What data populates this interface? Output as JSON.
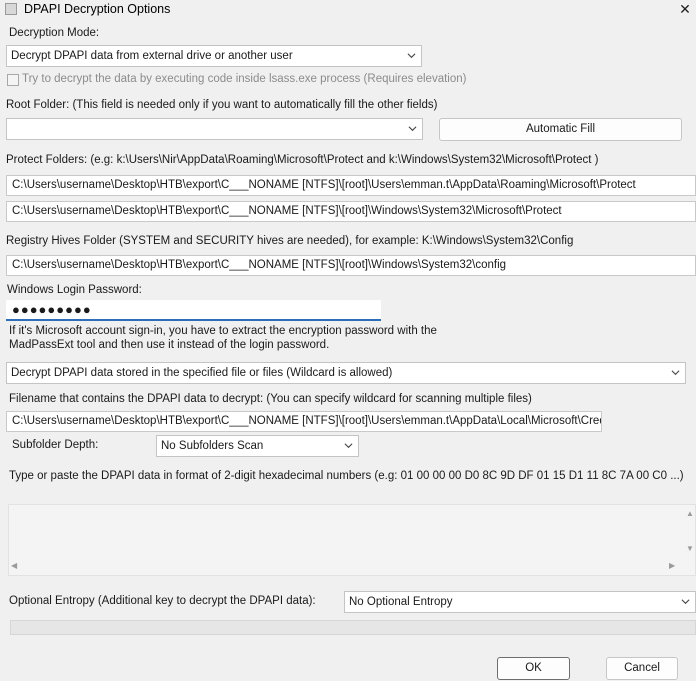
{
  "window": {
    "title": "DPAPI Decryption Options",
    "close_glyph": "✕"
  },
  "decryption_mode": {
    "label": "Decryption Mode:",
    "selected": "Decrypt DPAPI data from external drive or another user"
  },
  "lsass_option": {
    "label": "Try to decrypt the data by executing code inside lsass.exe process (Requires elevation)",
    "checked": false,
    "enabled": false
  },
  "root_folder": {
    "label": "Root Folder: (This field is needed only if you want to automatically fill the other fields)",
    "value": "",
    "auto_fill_label": "Automatic Fill"
  },
  "protect_folders": {
    "label": "Protect Folders: (e.g: k:\\Users\\Nir\\AppData\\Roaming\\Microsoft\\Protect and k:\\Windows\\System32\\Microsoft\\Protect )",
    "value_1": "C:\\Users\\username\\Desktop\\HTB\\export\\C___NONAME [NTFS]\\[root]\\Users\\emman.t\\AppData\\Roaming\\Microsoft\\Protect",
    "value_2": "C:\\Users\\username\\Desktop\\HTB\\export\\C___NONAME [NTFS]\\[root]\\Windows\\System32\\Microsoft\\Protect"
  },
  "registry_hives": {
    "label": "Registry Hives Folder (SYSTEM and SECURITY hives are needed), for example:  K:\\Windows\\System32\\Config",
    "value": "C:\\Users\\username\\Desktop\\HTB\\export\\C___NONAME [NTFS]\\[root]\\Windows\\System32\\config"
  },
  "login_password": {
    "label": "Windows Login Password:",
    "masked_value": "●●●●●●●●●",
    "note_line_1": "If it's Microsoft account sign-in, you have to extract the encryption password with the",
    "note_line_2": "MadPassExt tool and then use it instead of the login password."
  },
  "data_source": {
    "selected": "Decrypt DPAPI data stored in the specified file or files (Wildcard is allowed)"
  },
  "dpapi_file": {
    "label": "Filename that contains the DPAPI data to decrypt: (You can specify wildcard for scanning multiple files)",
    "value": "C:\\Users\\username\\Desktop\\HTB\\export\\C___NONAME [NTFS]\\[root]\\Users\\emman.t\\AppData\\Local\\Microsoft\\Credentials"
  },
  "subfolder_depth": {
    "label": "Subfolder Depth:",
    "selected": "No Subfolders Scan"
  },
  "hex_data": {
    "label": "Type or paste the DPAPI data in format of 2-digit hexadecimal numbers (e.g: 01 00 00 00 D0 8C 9D DF 01 15 D1 11 8C 7A 00 C0 ...)",
    "value": ""
  },
  "entropy": {
    "label": "Optional Entropy (Additional key to decrypt the DPAPI data):",
    "selected": "No Optional Entropy"
  },
  "buttons": {
    "ok": "OK",
    "cancel": "Cancel"
  },
  "icons": {
    "close": "close-icon",
    "chevron": "chevron-down-icon",
    "app": "app-icon"
  }
}
